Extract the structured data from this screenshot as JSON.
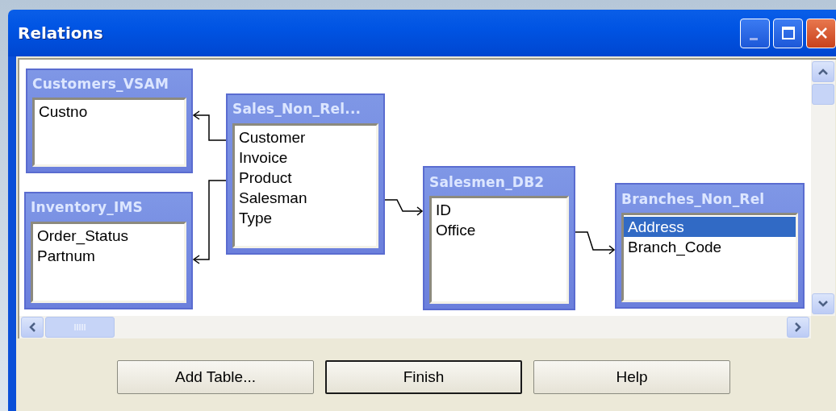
{
  "window": {
    "title": "Relations"
  },
  "tables": [
    {
      "name": "Customers_VSAM",
      "fields": [
        {
          "name": "Custno",
          "selected": false
        }
      ]
    },
    {
      "name": "Sales_Non_Rel...",
      "fields": [
        {
          "name": "Customer",
          "selected": false
        },
        {
          "name": "Invoice",
          "selected": false
        },
        {
          "name": "Product",
          "selected": false
        },
        {
          "name": "Salesman",
          "selected": false
        },
        {
          "name": "Type",
          "selected": false
        }
      ]
    },
    {
      "name": "Inventory_IMS",
      "fields": [
        {
          "name": "Order_Status",
          "selected": false
        },
        {
          "name": "Partnum",
          "selected": false
        }
      ]
    },
    {
      "name": "Salesmen_DB2",
      "fields": [
        {
          "name": "ID",
          "selected": false
        },
        {
          "name": "Office",
          "selected": false
        }
      ]
    },
    {
      "name": "Branches_Non_Rel",
      "fields": [
        {
          "name": "Address",
          "selected": true
        },
        {
          "name": "Branch_Code",
          "selected": false
        }
      ]
    }
  ],
  "buttons": [
    {
      "label": "Add Table...",
      "default": false
    },
    {
      "label": "Finish",
      "default": true
    },
    {
      "label": "Help",
      "default": false
    }
  ]
}
